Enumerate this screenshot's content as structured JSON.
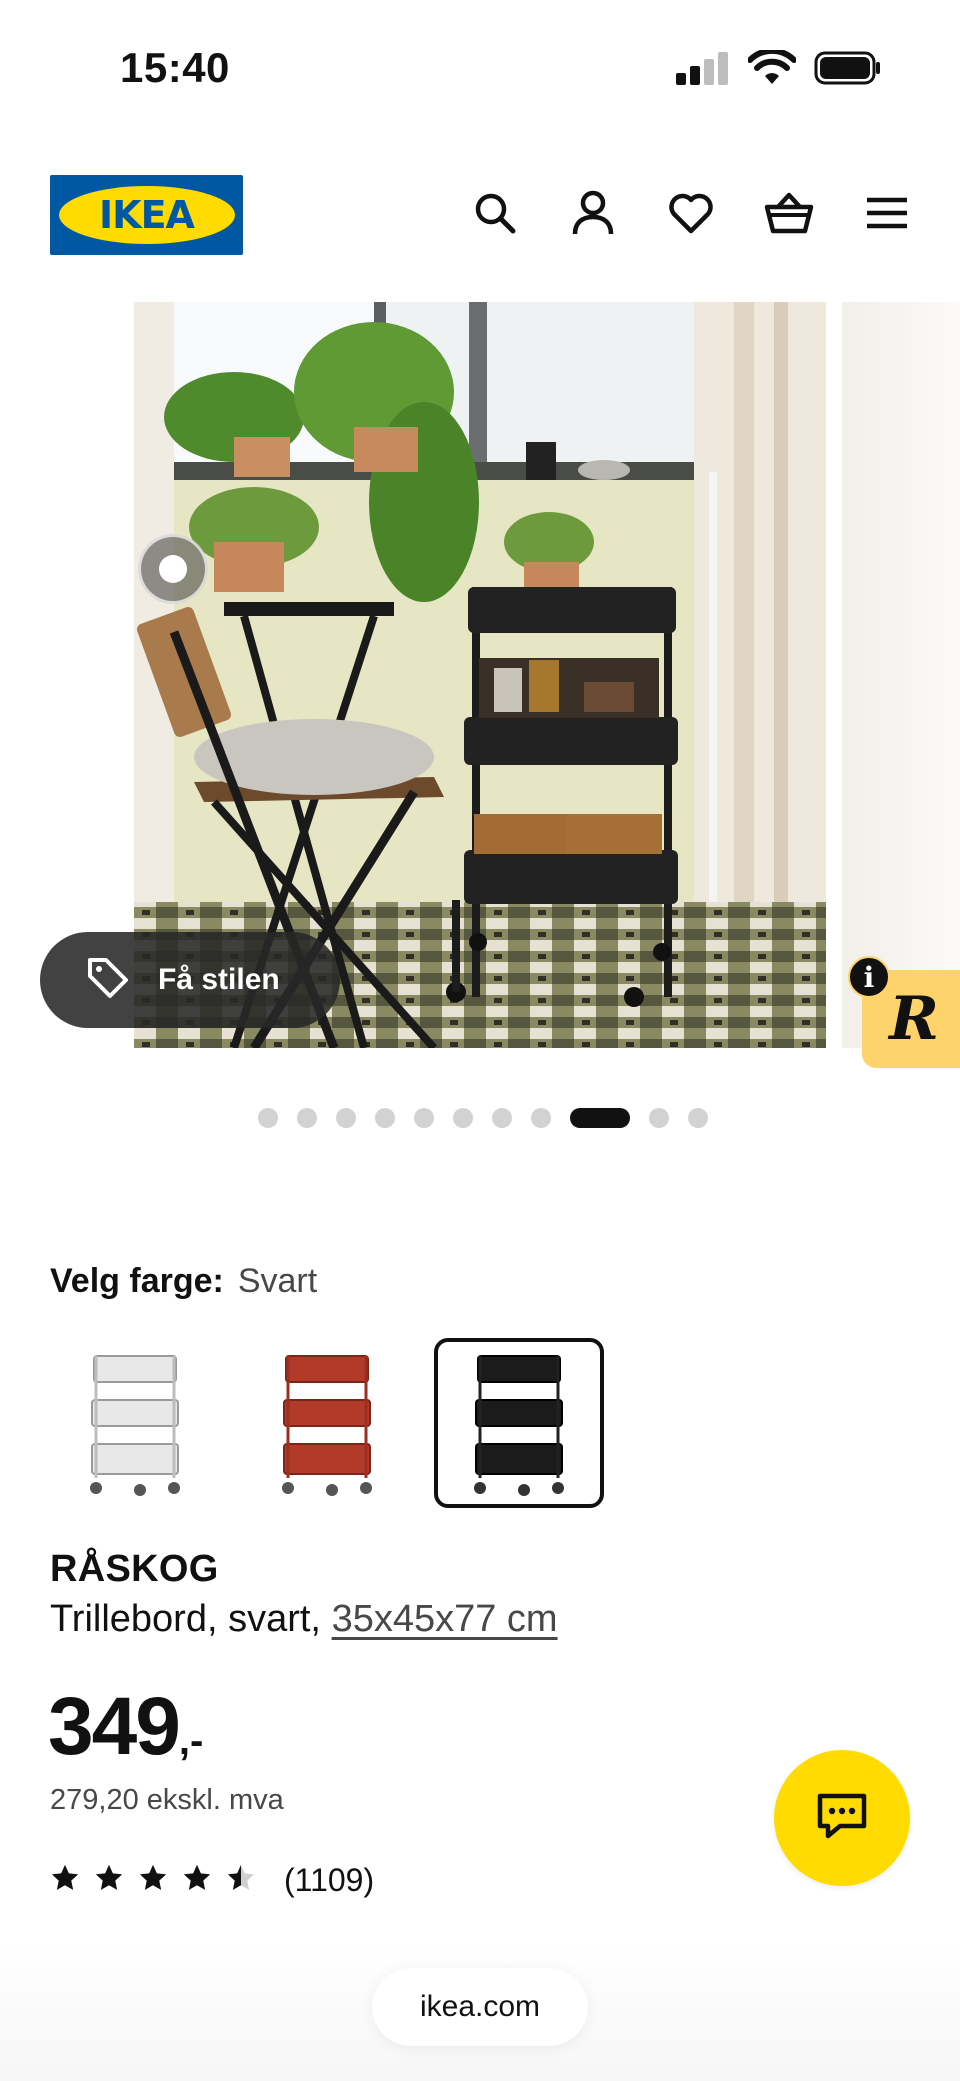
{
  "status_bar": {
    "time": "15:40",
    "icons": [
      "signal-icon",
      "wifi-icon",
      "battery-icon"
    ]
  },
  "header": {
    "logo_text": "IKEA",
    "icons": [
      "search-icon",
      "user-icon",
      "heart-icon",
      "basket-icon",
      "menu-icon"
    ]
  },
  "gallery": {
    "style_button_label": "Få stilen",
    "badge_letter": "R",
    "badge_info": "i",
    "dot_count": 11,
    "active_dot": 9
  },
  "color": {
    "label": "Velg farge:",
    "selected": "Svart",
    "options": [
      {
        "name": "Hvit",
        "hex": "#e6e6e6"
      },
      {
        "name": "Rød",
        "hex": "#b23a28"
      },
      {
        "name": "Svart",
        "hex": "#1b1b1b"
      }
    ]
  },
  "product": {
    "name": "RÅSKOG",
    "desc_prefix": "Trillebord, svart, ",
    "measure": "35x45x77 cm",
    "price_int": "349",
    "price_dec": ",-",
    "price_ex_vat": "279,20 ekskl. mva",
    "rating": 4.5,
    "rating_count": "(1109)"
  },
  "browser": {
    "url": "ikea.com"
  },
  "colors": {
    "ikea_blue": "#0058a3",
    "ikea_yellow": "#ffdb00",
    "text": "#111111",
    "muted": "#484848"
  }
}
